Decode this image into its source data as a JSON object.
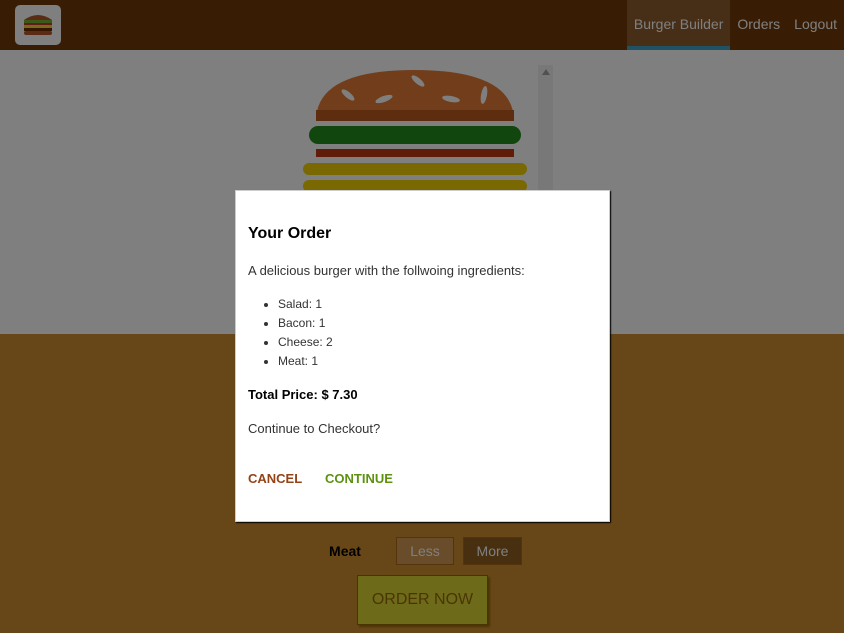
{
  "nav": {
    "items": [
      {
        "label": "Burger Builder",
        "active": true
      },
      {
        "label": "Orders",
        "active": false
      },
      {
        "label": "Logout",
        "active": false
      }
    ]
  },
  "logo_icon": "burger-logo-icon",
  "build_controls": {
    "visible_row": {
      "label": "Meat",
      "less_label": "Less",
      "more_label": "More"
    },
    "order_button_label": "ORDER NOW"
  },
  "modal": {
    "title": "Your Order",
    "intro": "A delicious burger with the follwoing ingredients:",
    "ingredients": [
      {
        "text": "Salad: 1"
      },
      {
        "text": "Bacon: 1"
      },
      {
        "text": "Cheese: 2"
      },
      {
        "text": "Meat: 1"
      }
    ],
    "total_price": "Total Price: $ 7.30",
    "checkout_prompt": "Continue to Checkout?",
    "cancel_label": "CANCEL",
    "continue_label": "CONTINUE"
  },
  "colors": {
    "toolbar": "#703b09",
    "controls_bg": "#cf8f2e",
    "active_underline": "#40a4c8",
    "cancel": "#944317",
    "continue": "#5c9210"
  }
}
